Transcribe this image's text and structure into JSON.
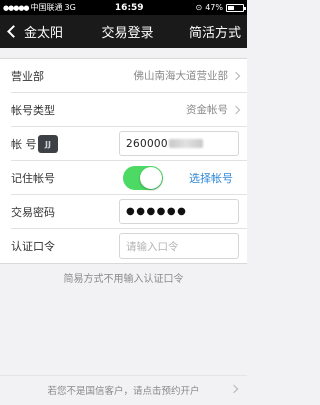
{
  "status_bar": {
    "signal": "●●●●●",
    "carrier": "中国联通",
    "network": "3G",
    "time": "16:59",
    "battery_text": "47%",
    "battery_level": 0.47
  },
  "nav": {
    "back_label": "金太阳",
    "title": "交易登录",
    "right_label": "简活方式"
  },
  "form": {
    "branch_label": "营业部",
    "branch_value": "佛山南海大道营业部",
    "account_type_label": "帐号类型",
    "account_type_value": "资金帐号",
    "account_label": "帐 号",
    "account_logo": "JJ",
    "account_value": "260000",
    "remember_label": "记住帐号",
    "remember_on": true,
    "select_account_link": "选择帐号",
    "password_label": "交易密码",
    "password_value": "●●●●●●",
    "auth_label": "认证口令",
    "auth_placeholder": "请输入口令"
  },
  "hint": "简易方式不用输入认证口令",
  "footer_link": "若您不是国信客户，请点击预约开户",
  "colors": {
    "toggle_on": "#4cd964",
    "link": "#2d88d8",
    "nav_bg": "#1a1a1a"
  }
}
